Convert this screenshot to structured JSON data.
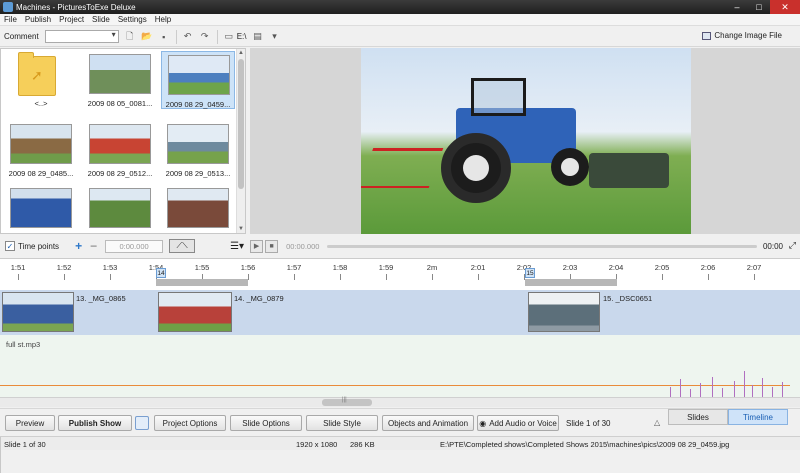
{
  "window": {
    "title": "Machines - PicturesToExe Deluxe",
    "buttons": [
      "–",
      "□",
      "✕"
    ]
  },
  "menu": [
    "File",
    "Publish",
    "Project",
    "Slide",
    "Settings",
    "Help"
  ],
  "toolbar": {
    "comment_label": "Comment",
    "comment_value": "",
    "drive_label": "E:\\",
    "change_image_label": "Change Image File"
  },
  "file_browser": {
    "items": [
      {
        "caption": "<..>",
        "type": "folder",
        "color": "#f6cf5a"
      },
      {
        "caption": "2009 08 05_0081...",
        "type": "image",
        "color": "#6f8f5a"
      },
      {
        "caption": "2009 08 29_0459...",
        "type": "image",
        "color": "#4d7fbf",
        "selected": true
      },
      {
        "caption": "2009 08 29_0485...",
        "type": "image",
        "color": "#8a6a44"
      },
      {
        "caption": "2009 08 29_0512...",
        "type": "image",
        "color": "#c84433"
      },
      {
        "caption": "2009 08 29_0513...",
        "type": "image",
        "color": "#6e8a9e"
      },
      {
        "caption": "",
        "type": "image",
        "color": "#2f5aa8"
      },
      {
        "caption": "",
        "type": "image",
        "color": "#5d8a3e"
      },
      {
        "caption": "",
        "type": "image",
        "color": "#7a4a3a"
      }
    ]
  },
  "controls": {
    "time_points_label": "Time points",
    "time_points_checked": true,
    "time_value": "0:00.000",
    "play_position": "00:00.000",
    "end_time": "00:00"
  },
  "timeline": {
    "ticks": [
      "1:51",
      "1:52",
      "1:53",
      "1:54",
      "1:55",
      "1:56",
      "1:57",
      "1:58",
      "1:59",
      "2m",
      "2:01",
      "2:02",
      "2:03",
      "2:04",
      "2:05",
      "2:06",
      "2:07"
    ],
    "markers": [
      "14",
      "15"
    ],
    "slides": [
      {
        "label": "13. _MG_0865",
        "color": "#3a5fa0"
      },
      {
        "label": "14. _MG_0879",
        "color": "#b8413a"
      },
      {
        "label": "15. _DSC0651",
        "color": "#5c6f7a"
      }
    ],
    "audio_label": "full st.mp3"
  },
  "buttons": {
    "preview": "Preview",
    "publish": "Publish Show",
    "project_options": "Project Options",
    "slide_options": "Slide Options",
    "slide_style": "Slide Style",
    "objects_animation": "Objects and Animation",
    "add_audio": "Add Audio or Voice",
    "slide_counter": "Slide 1 of 30"
  },
  "tabs": {
    "slides": "Slides",
    "timeline": "Timeline",
    "active": "timeline"
  },
  "status": {
    "slide": "Slide 1 of 30",
    "resolution": "1920 x 1080",
    "size": "286 KB",
    "path": "E:\\PTE\\Completed shows\\Completed Shows 2015\\machines\\pics\\2009 08 29_0459.jpg"
  }
}
